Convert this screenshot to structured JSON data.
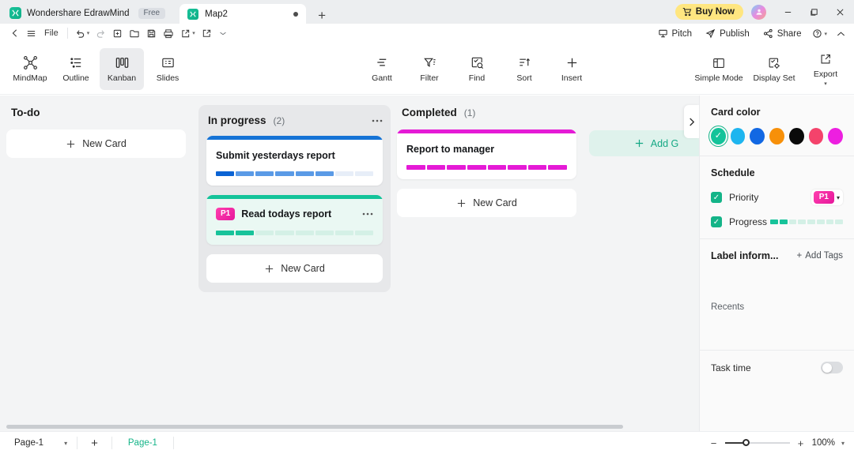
{
  "titlebar": {
    "app_name": "Wondershare EdrawMind",
    "free_badge": "Free",
    "doc_tab": "Map2",
    "new_tab_icon": "plus-icon",
    "buy_now": "Buy Now",
    "minimize": "–",
    "maximize": "❐",
    "close": "✕"
  },
  "quickbar": {
    "back_icon": "chevron-left-icon",
    "menu_icon": "hamburger-menu-icon",
    "file": "File",
    "undo_icon": "undo-icon",
    "redo_icon": "redo-icon",
    "new_icon": "new-document-icon",
    "open_icon": "open-folder-icon",
    "save_icon": "save-disk-icon",
    "print_icon": "print-icon",
    "export_icon": "export-share-icon",
    "import_icon": "import-icon",
    "more_icon": "chevron-down-icon",
    "right_items": [
      {
        "label": "Pitch",
        "icon": "pitch-icon"
      },
      {
        "label": "Publish",
        "icon": "publish-icon"
      },
      {
        "label": "Share",
        "icon": "share-icon"
      }
    ],
    "help": "?",
    "collapse_icon": "chevron-up-icon"
  },
  "ribbon": {
    "views": [
      {
        "label": "MindMap",
        "icon": "mindmap-icon",
        "active": false
      },
      {
        "label": "Outline",
        "icon": "outline-icon",
        "active": false
      },
      {
        "label": "Kanban",
        "icon": "kanban-icon",
        "active": true
      },
      {
        "label": "Slides",
        "icon": "slides-icon",
        "active": false
      }
    ],
    "tools": [
      {
        "label": "Gantt",
        "icon": "gantt-icon"
      },
      {
        "label": "Filter",
        "icon": "filter-icon"
      },
      {
        "label": "Find",
        "icon": "find-icon"
      },
      {
        "label": "Sort",
        "icon": "sort-icon"
      },
      {
        "label": "Insert",
        "icon": "plus-icon"
      }
    ],
    "right": [
      {
        "label": "Simple Mode",
        "icon": "layout-panel-icon"
      },
      {
        "label": "Display Set",
        "icon": "display-settings-icon"
      },
      {
        "label": "Export",
        "icon": "export-icon",
        "has_caret": true
      }
    ]
  },
  "board": {
    "next_icon": "chevron-right-icon",
    "add_group_label": "Add G",
    "add_group_icon": "plus-icon",
    "columns": [
      {
        "title": "To-do",
        "count": "",
        "shaded": false,
        "show_more": false,
        "new_card_label": "New Card",
        "cards": []
      },
      {
        "title": "In progress",
        "count": "(2)",
        "shaded": true,
        "show_more": true,
        "new_card_label": "New Card",
        "cards": [
          {
            "title": "Submit yesterdays report",
            "badge": "",
            "accent": "#1573d6",
            "bg": "#ffffff",
            "show_more": false,
            "segments_total": 8,
            "segments": [
              "#0a63d4",
              "#5a9ae6",
              "#5a9ae6",
              "#5a9ae6",
              "#5a9ae6",
              "#5a9ae6",
              "#e7eef8",
              "#e7eef8"
            ]
          },
          {
            "title": "Read todays report",
            "badge": "P1",
            "accent": "#14c39a",
            "bg": "#eaf8f3",
            "show_more": true,
            "segments_total": 8,
            "segments": [
              "#17c39a",
              "#17c39a",
              "#d4f0e6",
              "#d4f0e6",
              "#d4f0e6",
              "#d4f0e6",
              "#d4f0e6",
              "#d4f0e6"
            ]
          }
        ]
      },
      {
        "title": "Completed",
        "count": "(1)",
        "shaded": false,
        "show_more": false,
        "new_card_label": "New Card",
        "cards": [
          {
            "title": "Report to manager",
            "badge": "",
            "accent": "#e51ad6",
            "bg": "#ffffff",
            "show_more": false,
            "segments_total": 8,
            "segments": [
              "#e51ad6",
              "#e51ad6",
              "#e51ad6",
              "#e51ad6",
              "#e51ad6",
              "#e51ad6",
              "#e51ad6",
              "#e51ad6"
            ]
          }
        ]
      }
    ]
  },
  "right_panel": {
    "card_color_title": "Card color",
    "swatches": [
      {
        "color": "#14c39a",
        "selected": true
      },
      {
        "color": "#1eb5ef",
        "selected": false
      },
      {
        "color": "#1268e3",
        "selected": false
      },
      {
        "color": "#f79009",
        "selected": false
      },
      {
        "color": "#0a0a0a",
        "selected": false
      },
      {
        "color": "#f4436b",
        "selected": false
      },
      {
        "color": "#ed1fe0",
        "selected": false
      }
    ],
    "schedule_title": "Schedule",
    "priority_label": "Priority",
    "priority_value": "P1",
    "priority_caret_icon": "chevron-down-icon",
    "progress_label": "Progress",
    "progress_segments": [
      "#17c39a",
      "#17c39a",
      "#d4f0e6",
      "#d4f0e6",
      "#d4f0e6",
      "#d4f0e6",
      "#d4f0e6",
      "#d4f0e6"
    ],
    "label_info_title": "Label inform...",
    "add_tags_label": "Add Tags",
    "add_tags_icon": "plus-icon",
    "recents_label": "Recents",
    "task_time_label": "Task time",
    "task_time_on": false
  },
  "statusbar": {
    "page_select": "Page-1",
    "page_select_caret": "chevron-down-icon",
    "add_page_icon": "plus-icon",
    "page_tab": "Page-1",
    "zoom_minus": "−",
    "zoom_plus": "+",
    "zoom_percent": "100%",
    "zoom_caret_icon": "chevron-down-icon"
  }
}
